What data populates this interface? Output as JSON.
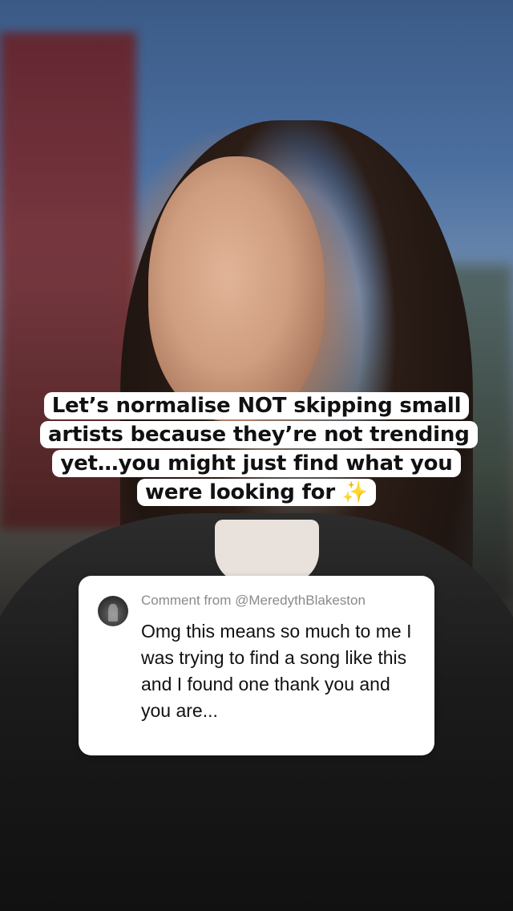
{
  "caption": {
    "text": "Let’s normalise NOT skipping small artists because they’re not trending yet…you might just find what you were looking for ✨"
  },
  "comment": {
    "header": "Comment from @MeredythBlakeston",
    "body": "Omg this means so much to me I was trying to find a song like this and I found one thank you and you are..."
  },
  "colors": {
    "caption_bg": "#ffffff",
    "caption_text": "#111111",
    "comment_header_text": "#8a8a8a"
  },
  "icons": {
    "avatar": "user-avatar-icon"
  }
}
